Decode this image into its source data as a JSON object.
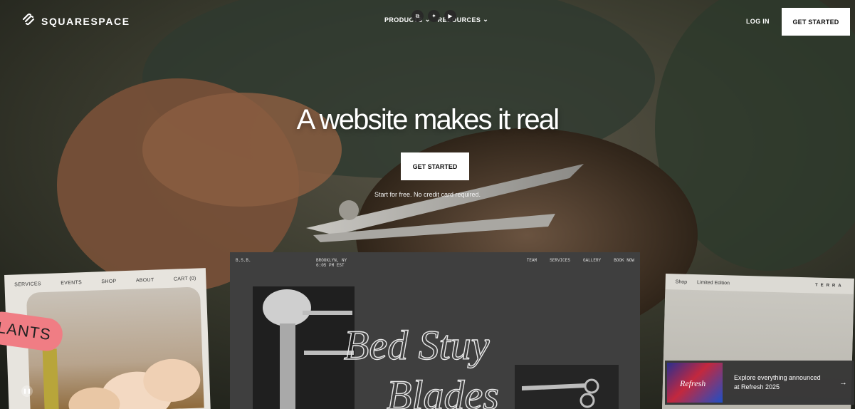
{
  "brand": {
    "name": "SQUARESPACE"
  },
  "nav": {
    "items": [
      {
        "label": "PRODUCTS"
      },
      {
        "label": "RESOURCES"
      }
    ],
    "login": "LOG IN",
    "cta": "GET STARTED"
  },
  "hero": {
    "title": "A website makes it real",
    "cta": "GET STARTED",
    "subtitle": "Start for free. No credit card required."
  },
  "preview_left": {
    "nav": [
      "SERVICES",
      "EVENTS",
      "SHOP",
      "ABOUT",
      "CART (0)"
    ],
    "tag": "LANTS"
  },
  "preview_center": {
    "brand": "B.S.B.",
    "location": "BROOKLYN, NY",
    "time": "6:05 PM EST",
    "nav": [
      "TEAM",
      "SERVICES",
      "GALLERY",
      "BOOK NOW"
    ],
    "script_title_1": "Bed Stuy",
    "script_title_2": "Blades"
  },
  "preview_right": {
    "nav": [
      "Shop",
      "Limited Edition"
    ],
    "brand": "TERRA"
  },
  "refresh_banner": {
    "thumb_text": "Refresh",
    "line1": "Explore everything announced",
    "line2": "at Refresh 2025"
  },
  "icons": {
    "brand": "squarespace-logo-icon",
    "pause": "pause-icon",
    "arrow": "arrow-right-icon",
    "chevron": "chevron-down-icon"
  }
}
